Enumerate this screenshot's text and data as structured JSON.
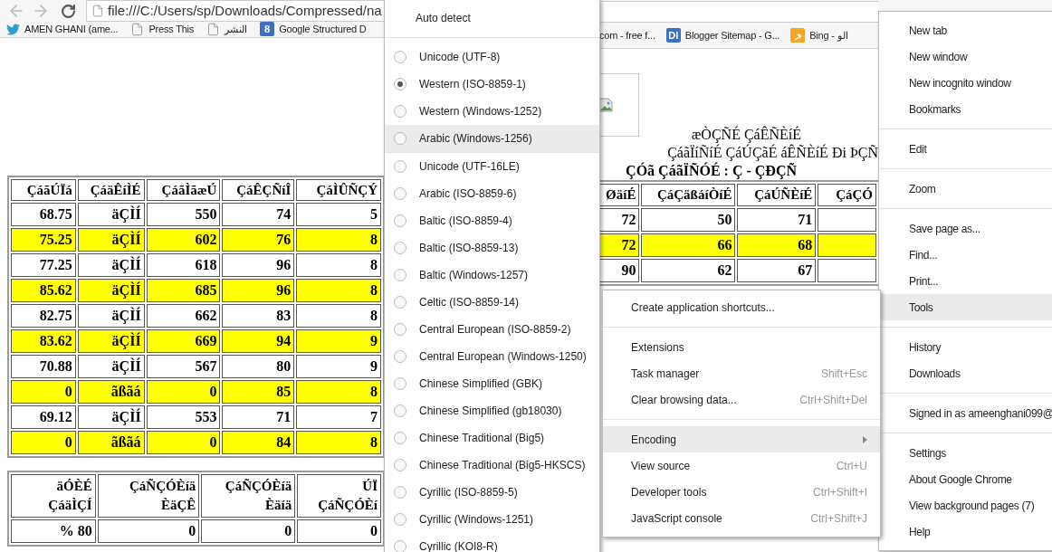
{
  "toolbar": {
    "address": "file:///C:/Users/sp/Downloads/Compressed/na"
  },
  "bookmarks_left": [
    {
      "kind": "twitter",
      "label": "AMEN GHANI (ame..."
    },
    {
      "kind": "page",
      "label": "Press This"
    },
    {
      "kind": "page",
      "label": "النشر"
    },
    {
      "kind": "letters",
      "icon_text": "8",
      "label": "Google Structured D"
    }
  ],
  "bookmarks_middle": [
    {
      "kind": "none",
      "label": "com - free f..."
    },
    {
      "kind": "letters",
      "icon_text": "DI",
      "label": "Blogger Sitemap - G..."
    },
    {
      "kind": "bing",
      "label": "Bing - الو"
    }
  ],
  "page": {
    "titles": [
      "æÒÇÑÉ ÇáÊÑÈíÉ",
      "ÇáãÏíÑíÉ ÇáÚÇãÉ áÊÑÈíÉ Ði ÞÇÑ"
    ],
    "school": "ÇÓã ÇáãÏÑÓÉ : Ç - ÇÐÇÑ",
    "grades_table": {
      "columns": [
        "ÇáãÚÏá",
        "ÇáäÊíÌÉ",
        "ÇáãÌãæÚ",
        "ÇáÊÇÑíÎ",
        "ÇáÌÛÑÇÝ"
      ],
      "rows": [
        {
          "highlighted": false,
          "cells": [
            "68.75",
            "äÇÌÍ",
            "550",
            "74",
            "5"
          ]
        },
        {
          "highlighted": true,
          "cells": [
            "75.25",
            "äÇÌÍ",
            "602",
            "76",
            "8"
          ]
        },
        {
          "highlighted": false,
          "cells": [
            "77.25",
            "äÇÌÍ",
            "618",
            "96",
            "8"
          ]
        },
        {
          "highlighted": true,
          "cells": [
            "85.62",
            "äÇÌÍ",
            "685",
            "96",
            "8"
          ]
        },
        {
          "highlighted": false,
          "cells": [
            "82.75",
            "äÇÌÍ",
            "662",
            "83",
            "8"
          ]
        },
        {
          "highlighted": true,
          "cells": [
            "83.62",
            "äÇÌÍ",
            "669",
            "94",
            "9"
          ]
        },
        {
          "highlighted": false,
          "cells": [
            "70.88",
            "äÇÌÍ",
            "567",
            "80",
            "9"
          ]
        },
        {
          "highlighted": true,
          "cells": [
            "0",
            "ãßãá",
            "0",
            "85",
            "8"
          ]
        },
        {
          "highlighted": false,
          "cells": [
            "69.12",
            "äÇÌÍ",
            "553",
            "71",
            "7"
          ]
        },
        {
          "highlighted": true,
          "cells": [
            "0",
            "ãßãá",
            "0",
            "84",
            "8"
          ]
        }
      ]
    },
    "grades_table_right": {
      "columns": [
        "ØäíÉ",
        "ÇáÇäßáíÒíÉ",
        "ÇáÚÑÈíÉ",
        "ÇáÇÓ"
      ],
      "rows": [
        {
          "highlighted": false,
          "cells": [
            "72",
            "50",
            "71"
          ]
        },
        {
          "highlighted": true,
          "cells": [
            "72",
            "66",
            "68"
          ]
        },
        {
          "highlighted": false,
          "cells": [
            "90",
            "62",
            "67"
          ]
        }
      ]
    },
    "summary_table": {
      "columns": [
        "äÓÈÉ ÇáäÌÇÍ",
        "ÇáÑÇÓÈíä ÈäÇÊ",
        "ÇáÑÇÓÈíä Èäíä",
        "ÚÏ ÇáÑÇÓÈí"
      ],
      "rows": [
        [
          "% 80",
          "0",
          "0",
          "0"
        ]
      ]
    }
  },
  "encoding_menu": {
    "groups": [
      {
        "items": [
          {
            "kind": "plain",
            "label": "Auto detect",
            "highlighted": false
          }
        ]
      },
      {
        "items": [
          {
            "kind": "radio",
            "label": "Unicode (UTF-8)",
            "selected": false,
            "highlighted": false
          },
          {
            "kind": "radio",
            "label": "Western (ISO-8859-1)",
            "selected": true,
            "highlighted": false
          },
          {
            "kind": "radio",
            "label": "Western (Windows-1252)",
            "selected": false,
            "highlighted": false
          },
          {
            "kind": "radio",
            "label": "Arabic (Windows-1256)",
            "selected": false,
            "highlighted": true
          }
        ]
      },
      {
        "items": [
          {
            "kind": "radio",
            "label": "Unicode (UTF-16LE)",
            "selected": false,
            "highlighted": false
          },
          {
            "kind": "radio",
            "label": "Arabic (ISO-8859-6)",
            "selected": false,
            "highlighted": false
          },
          {
            "kind": "radio",
            "label": "Baltic (ISO-8859-4)",
            "selected": false,
            "highlighted": false
          },
          {
            "kind": "radio",
            "label": "Baltic (ISO-8859-13)",
            "selected": false,
            "highlighted": false
          },
          {
            "kind": "radio",
            "label": "Baltic (Windows-1257)",
            "selected": false,
            "highlighted": false
          },
          {
            "kind": "radio",
            "label": "Celtic (ISO-8859-14)",
            "selected": false,
            "highlighted": false
          },
          {
            "kind": "radio",
            "label": "Central European (ISO-8859-2)",
            "selected": false,
            "highlighted": false
          },
          {
            "kind": "radio",
            "label": "Central European (Windows-1250)",
            "selected": false,
            "highlighted": false
          },
          {
            "kind": "radio",
            "label": "Chinese Simplified (GBK)",
            "selected": false,
            "highlighted": false
          },
          {
            "kind": "radio",
            "label": "Chinese Simplified (gb18030)",
            "selected": false,
            "highlighted": false
          },
          {
            "kind": "radio",
            "label": "Chinese Traditional (Big5)",
            "selected": false,
            "highlighted": false
          },
          {
            "kind": "radio",
            "label": "Chinese Traditional (Big5-HKSCS)",
            "selected": false,
            "highlighted": false
          },
          {
            "kind": "radio",
            "label": "Cyrillic (ISO-8859-5)",
            "selected": false,
            "highlighted": false
          },
          {
            "kind": "radio",
            "label": "Cyrillic (Windows-1251)",
            "selected": false,
            "highlighted": false
          },
          {
            "kind": "radio",
            "label": "Cyrillic (KOI8-R)",
            "selected": false,
            "highlighted": false
          }
        ]
      }
    ]
  },
  "tools_menu": {
    "groups": [
      {
        "items": [
          {
            "label": "Create application shortcuts...",
            "highlighted": false,
            "submenu": false
          }
        ]
      },
      {
        "items": [
          {
            "label": "Extensions",
            "highlighted": false,
            "submenu": false
          },
          {
            "label": "Task manager",
            "shortcut": "Shift+Esc",
            "highlighted": false,
            "submenu": false
          },
          {
            "label": "Clear browsing data...",
            "shortcut": "Ctrl+Shift+Del",
            "highlighted": false,
            "submenu": false
          }
        ]
      },
      {
        "items": [
          {
            "label": "Encoding",
            "highlighted": true,
            "submenu": true
          },
          {
            "label": "View source",
            "shortcut": "Ctrl+U",
            "highlighted": false,
            "submenu": false
          },
          {
            "label": "Developer tools",
            "shortcut": "Ctrl+Shift+I",
            "highlighted": false,
            "submenu": false
          },
          {
            "label": "JavaScript console",
            "shortcut": "Ctrl+Shift+J",
            "highlighted": false,
            "submenu": false
          }
        ]
      }
    ]
  },
  "main_menu": {
    "groups": [
      {
        "items": [
          {
            "label": "New tab",
            "highlighted": false
          },
          {
            "label": "New window",
            "highlighted": false
          },
          {
            "label": "New incognito window",
            "highlighted": false
          },
          {
            "label": "Bookmarks",
            "highlighted": false
          }
        ]
      },
      {
        "items": [
          {
            "label": "Edit",
            "highlighted": false
          }
        ]
      },
      {
        "items": [
          {
            "label": "Zoom",
            "highlighted": false
          }
        ]
      },
      {
        "items": [
          {
            "label": "Save page as...",
            "highlighted": false
          },
          {
            "label": "Find...",
            "highlighted": false
          },
          {
            "label": "Print...",
            "highlighted": false
          },
          {
            "label": "Tools",
            "highlighted": true
          }
        ]
      },
      {
        "items": [
          {
            "label": "History",
            "highlighted": false
          },
          {
            "label": "Downloads",
            "highlighted": false
          }
        ]
      },
      {
        "items": [
          {
            "label": "Signed in as ameenghani099@",
            "highlighted": false
          }
        ]
      },
      {
        "items": [
          {
            "label": "Settings",
            "highlighted": false
          },
          {
            "label": "About Google Chrome",
            "highlighted": false
          },
          {
            "label": "View background pages (7)",
            "highlighted": false
          },
          {
            "label": "Help",
            "highlighted": false
          }
        ]
      }
    ]
  }
}
